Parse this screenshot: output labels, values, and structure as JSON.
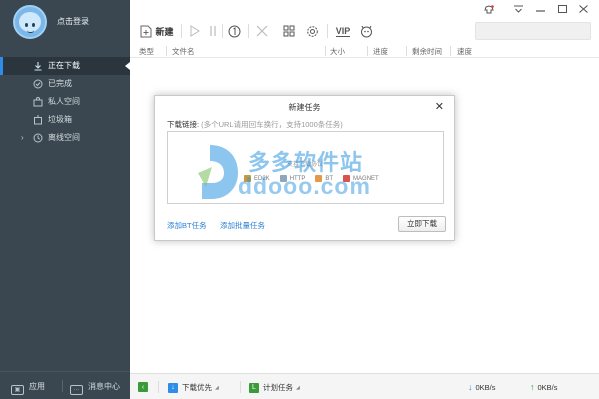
{
  "sidebar": {
    "login_text": "点击登录",
    "items": [
      {
        "label": "正在下载",
        "icon": "download-icon",
        "active": true
      },
      {
        "label": "已完成",
        "icon": "check-circle-icon",
        "active": false
      },
      {
        "label": "私人空间",
        "icon": "lock-folder-icon",
        "active": false
      },
      {
        "label": "垃圾箱",
        "icon": "trash-icon",
        "active": false
      },
      {
        "label": "离线空间",
        "icon": "cloud-icon",
        "active": false
      }
    ],
    "apps_label": "应用",
    "messages_label": "消息中心"
  },
  "toolbar": {
    "new_label": "新建",
    "vip_label": "VIP"
  },
  "table": {
    "columns": [
      "类型",
      "文件名",
      "大小",
      "进度",
      "剩余时间",
      "速度"
    ]
  },
  "statusbar": {
    "download_priority": "下载优先",
    "schedule": "计划任务",
    "down_speed": "0KB/s",
    "up_speed": "0KB/s"
  },
  "dialog": {
    "title": "新建任务",
    "link_label": "下载链接:",
    "link_hint": "(多个URL请用回车换行，支持1000条任务)",
    "protocol_hint": "支持下载协议",
    "protocols": [
      "ED2K",
      "HTTP",
      "BT",
      "MAGNET"
    ],
    "add_bt": "添加BT任务",
    "add_batch": "添加批量任务",
    "download_now": "立即下载"
  },
  "watermark": {
    "cn": "多多软件站",
    "en": "ddooo.com"
  },
  "colors": {
    "sidebar_bg": "#3a4750",
    "accent": "#2e8de6",
    "link": "#2a7fd4"
  }
}
